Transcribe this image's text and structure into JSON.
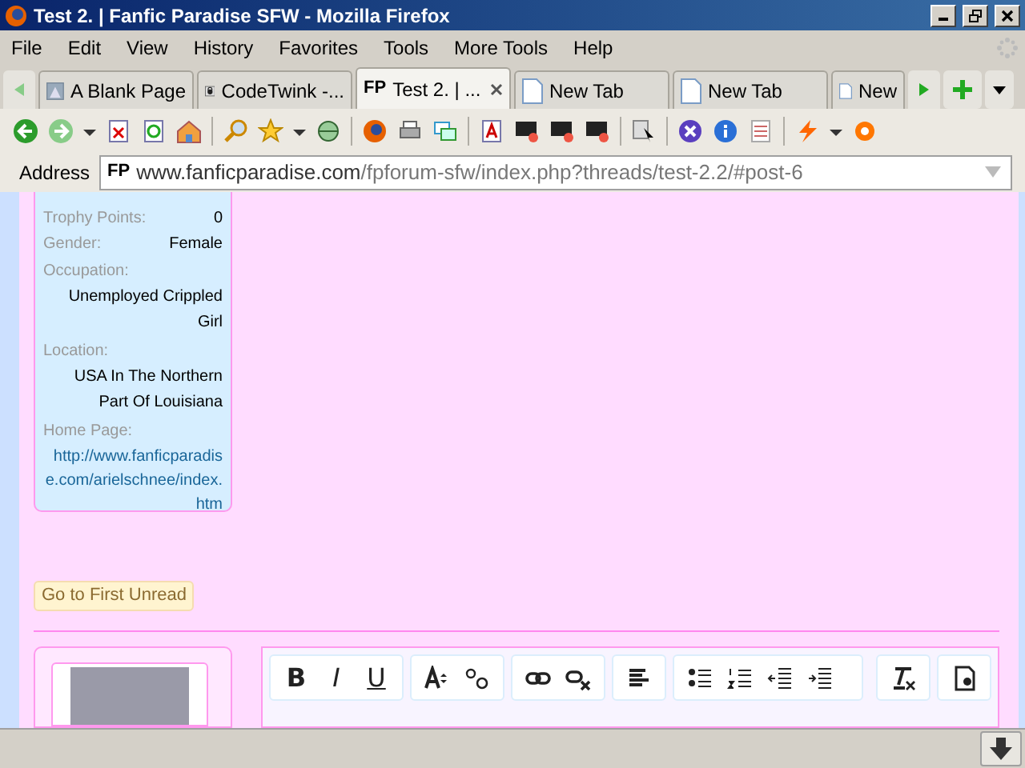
{
  "window": {
    "title": "Test 2. | Fanfic Paradise SFW - Mozilla Firefox"
  },
  "menu": [
    "File",
    "Edit",
    "View",
    "History",
    "Favorites",
    "Tools",
    "More Tools",
    "Help"
  ],
  "tabs": [
    {
      "label": "A Blank Page",
      "selected": false,
      "kind": "photo"
    },
    {
      "label": "CodeTwink -...",
      "selected": false,
      "kind": "lock"
    },
    {
      "label": "Test 2. | ...",
      "selected": true,
      "kind": "fp",
      "badge": "FP"
    },
    {
      "label": "New Tab",
      "selected": false,
      "kind": "page"
    },
    {
      "label": "New Tab",
      "selected": false,
      "kind": "page"
    },
    {
      "label": "New",
      "selected": false,
      "kind": "page"
    }
  ],
  "address": {
    "label": "Address",
    "site_badge": "FP",
    "domain": "www.fanficparadise.com",
    "path": "/fpforum-sfw/index.php?threads/test-2.2/#post-6"
  },
  "profile": [
    {
      "label": "Trophy Points:",
      "value": "0",
      "kind": "text"
    },
    {
      "label": "Gender:",
      "value": "Female",
      "kind": "text"
    },
    {
      "label": "Occupation:",
      "value": "Unemployed Crippled Girl",
      "kind": "text"
    },
    {
      "label": "Location:",
      "value": "USA In The Northern Part Of Louisiana",
      "kind": "text"
    },
    {
      "label": "Home Page:",
      "value": "http://www.fanficparadise.com/arielschnee/index.htm",
      "kind": "link"
    }
  ],
  "first_unread": "Go to First Unread",
  "editor": {
    "format_buttons": [
      "B",
      "I",
      "U"
    ]
  }
}
